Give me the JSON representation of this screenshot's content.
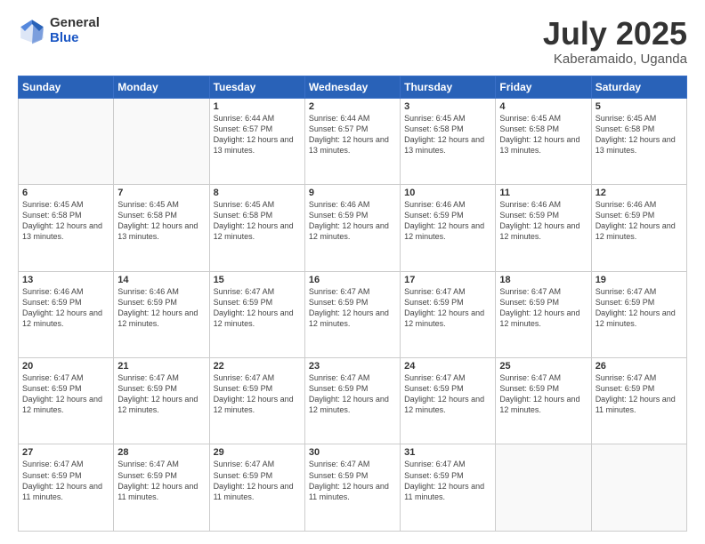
{
  "logo": {
    "general": "General",
    "blue": "Blue"
  },
  "header": {
    "month_year": "July 2025",
    "location": "Kaberamaido, Uganda"
  },
  "weekdays": [
    "Sunday",
    "Monday",
    "Tuesday",
    "Wednesday",
    "Thursday",
    "Friday",
    "Saturday"
  ],
  "weeks": [
    [
      {
        "day": "",
        "sunrise": "",
        "sunset": "",
        "daylight": ""
      },
      {
        "day": "",
        "sunrise": "",
        "sunset": "",
        "daylight": ""
      },
      {
        "day": "1",
        "sunrise": "Sunrise: 6:44 AM",
        "sunset": "Sunset: 6:57 PM",
        "daylight": "Daylight: 12 hours and 13 minutes."
      },
      {
        "day": "2",
        "sunrise": "Sunrise: 6:44 AM",
        "sunset": "Sunset: 6:57 PM",
        "daylight": "Daylight: 12 hours and 13 minutes."
      },
      {
        "day": "3",
        "sunrise": "Sunrise: 6:45 AM",
        "sunset": "Sunset: 6:58 PM",
        "daylight": "Daylight: 12 hours and 13 minutes."
      },
      {
        "day": "4",
        "sunrise": "Sunrise: 6:45 AM",
        "sunset": "Sunset: 6:58 PM",
        "daylight": "Daylight: 12 hours and 13 minutes."
      },
      {
        "day": "5",
        "sunrise": "Sunrise: 6:45 AM",
        "sunset": "Sunset: 6:58 PM",
        "daylight": "Daylight: 12 hours and 13 minutes."
      }
    ],
    [
      {
        "day": "6",
        "sunrise": "Sunrise: 6:45 AM",
        "sunset": "Sunset: 6:58 PM",
        "daylight": "Daylight: 12 hours and 13 minutes."
      },
      {
        "day": "7",
        "sunrise": "Sunrise: 6:45 AM",
        "sunset": "Sunset: 6:58 PM",
        "daylight": "Daylight: 12 hours and 13 minutes."
      },
      {
        "day": "8",
        "sunrise": "Sunrise: 6:45 AM",
        "sunset": "Sunset: 6:58 PM",
        "daylight": "Daylight: 12 hours and 12 minutes."
      },
      {
        "day": "9",
        "sunrise": "Sunrise: 6:46 AM",
        "sunset": "Sunset: 6:59 PM",
        "daylight": "Daylight: 12 hours and 12 minutes."
      },
      {
        "day": "10",
        "sunrise": "Sunrise: 6:46 AM",
        "sunset": "Sunset: 6:59 PM",
        "daylight": "Daylight: 12 hours and 12 minutes."
      },
      {
        "day": "11",
        "sunrise": "Sunrise: 6:46 AM",
        "sunset": "Sunset: 6:59 PM",
        "daylight": "Daylight: 12 hours and 12 minutes."
      },
      {
        "day": "12",
        "sunrise": "Sunrise: 6:46 AM",
        "sunset": "Sunset: 6:59 PM",
        "daylight": "Daylight: 12 hours and 12 minutes."
      }
    ],
    [
      {
        "day": "13",
        "sunrise": "Sunrise: 6:46 AM",
        "sunset": "Sunset: 6:59 PM",
        "daylight": "Daylight: 12 hours and 12 minutes."
      },
      {
        "day": "14",
        "sunrise": "Sunrise: 6:46 AM",
        "sunset": "Sunset: 6:59 PM",
        "daylight": "Daylight: 12 hours and 12 minutes."
      },
      {
        "day": "15",
        "sunrise": "Sunrise: 6:47 AM",
        "sunset": "Sunset: 6:59 PM",
        "daylight": "Daylight: 12 hours and 12 minutes."
      },
      {
        "day": "16",
        "sunrise": "Sunrise: 6:47 AM",
        "sunset": "Sunset: 6:59 PM",
        "daylight": "Daylight: 12 hours and 12 minutes."
      },
      {
        "day": "17",
        "sunrise": "Sunrise: 6:47 AM",
        "sunset": "Sunset: 6:59 PM",
        "daylight": "Daylight: 12 hours and 12 minutes."
      },
      {
        "day": "18",
        "sunrise": "Sunrise: 6:47 AM",
        "sunset": "Sunset: 6:59 PM",
        "daylight": "Daylight: 12 hours and 12 minutes."
      },
      {
        "day": "19",
        "sunrise": "Sunrise: 6:47 AM",
        "sunset": "Sunset: 6:59 PM",
        "daylight": "Daylight: 12 hours and 12 minutes."
      }
    ],
    [
      {
        "day": "20",
        "sunrise": "Sunrise: 6:47 AM",
        "sunset": "Sunset: 6:59 PM",
        "daylight": "Daylight: 12 hours and 12 minutes."
      },
      {
        "day": "21",
        "sunrise": "Sunrise: 6:47 AM",
        "sunset": "Sunset: 6:59 PM",
        "daylight": "Daylight: 12 hours and 12 minutes."
      },
      {
        "day": "22",
        "sunrise": "Sunrise: 6:47 AM",
        "sunset": "Sunset: 6:59 PM",
        "daylight": "Daylight: 12 hours and 12 minutes."
      },
      {
        "day": "23",
        "sunrise": "Sunrise: 6:47 AM",
        "sunset": "Sunset: 6:59 PM",
        "daylight": "Daylight: 12 hours and 12 minutes."
      },
      {
        "day": "24",
        "sunrise": "Sunrise: 6:47 AM",
        "sunset": "Sunset: 6:59 PM",
        "daylight": "Daylight: 12 hours and 12 minutes."
      },
      {
        "day": "25",
        "sunrise": "Sunrise: 6:47 AM",
        "sunset": "Sunset: 6:59 PM",
        "daylight": "Daylight: 12 hours and 12 minutes."
      },
      {
        "day": "26",
        "sunrise": "Sunrise: 6:47 AM",
        "sunset": "Sunset: 6:59 PM",
        "daylight": "Daylight: 12 hours and 11 minutes."
      }
    ],
    [
      {
        "day": "27",
        "sunrise": "Sunrise: 6:47 AM",
        "sunset": "Sunset: 6:59 PM",
        "daylight": "Daylight: 12 hours and 11 minutes."
      },
      {
        "day": "28",
        "sunrise": "Sunrise: 6:47 AM",
        "sunset": "Sunset: 6:59 PM",
        "daylight": "Daylight: 12 hours and 11 minutes."
      },
      {
        "day": "29",
        "sunrise": "Sunrise: 6:47 AM",
        "sunset": "Sunset: 6:59 PM",
        "daylight": "Daylight: 12 hours and 11 minutes."
      },
      {
        "day": "30",
        "sunrise": "Sunrise: 6:47 AM",
        "sunset": "Sunset: 6:59 PM",
        "daylight": "Daylight: 12 hours and 11 minutes."
      },
      {
        "day": "31",
        "sunrise": "Sunrise: 6:47 AM",
        "sunset": "Sunset: 6:59 PM",
        "daylight": "Daylight: 12 hours and 11 minutes."
      },
      {
        "day": "",
        "sunrise": "",
        "sunset": "",
        "daylight": ""
      },
      {
        "day": "",
        "sunrise": "",
        "sunset": "",
        "daylight": ""
      }
    ]
  ]
}
